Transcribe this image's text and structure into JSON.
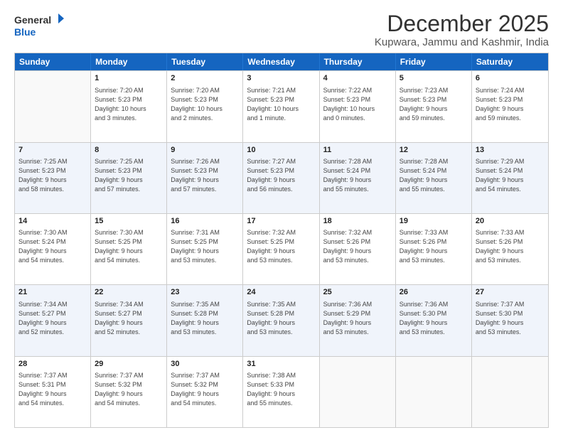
{
  "logo": {
    "line1": "General",
    "line2": "Blue"
  },
  "title": "December 2025",
  "subtitle": "Kupwara, Jammu and Kashmir, India",
  "days": [
    "Sunday",
    "Monday",
    "Tuesday",
    "Wednesday",
    "Thursday",
    "Friday",
    "Saturday"
  ],
  "rows": [
    [
      {
        "day": "",
        "info": ""
      },
      {
        "day": "1",
        "info": "Sunrise: 7:20 AM\nSunset: 5:23 PM\nDaylight: 10 hours\nand 3 minutes."
      },
      {
        "day": "2",
        "info": "Sunrise: 7:20 AM\nSunset: 5:23 PM\nDaylight: 10 hours\nand 2 minutes."
      },
      {
        "day": "3",
        "info": "Sunrise: 7:21 AM\nSunset: 5:23 PM\nDaylight: 10 hours\nand 1 minute."
      },
      {
        "day": "4",
        "info": "Sunrise: 7:22 AM\nSunset: 5:23 PM\nDaylight: 10 hours\nand 0 minutes."
      },
      {
        "day": "5",
        "info": "Sunrise: 7:23 AM\nSunset: 5:23 PM\nDaylight: 9 hours\nand 59 minutes."
      },
      {
        "day": "6",
        "info": "Sunrise: 7:24 AM\nSunset: 5:23 PM\nDaylight: 9 hours\nand 59 minutes."
      }
    ],
    [
      {
        "day": "7",
        "info": "Sunrise: 7:25 AM\nSunset: 5:23 PM\nDaylight: 9 hours\nand 58 minutes."
      },
      {
        "day": "8",
        "info": "Sunrise: 7:25 AM\nSunset: 5:23 PM\nDaylight: 9 hours\nand 57 minutes."
      },
      {
        "day": "9",
        "info": "Sunrise: 7:26 AM\nSunset: 5:23 PM\nDaylight: 9 hours\nand 57 minutes."
      },
      {
        "day": "10",
        "info": "Sunrise: 7:27 AM\nSunset: 5:23 PM\nDaylight: 9 hours\nand 56 minutes."
      },
      {
        "day": "11",
        "info": "Sunrise: 7:28 AM\nSunset: 5:24 PM\nDaylight: 9 hours\nand 55 minutes."
      },
      {
        "day": "12",
        "info": "Sunrise: 7:28 AM\nSunset: 5:24 PM\nDaylight: 9 hours\nand 55 minutes."
      },
      {
        "day": "13",
        "info": "Sunrise: 7:29 AM\nSunset: 5:24 PM\nDaylight: 9 hours\nand 54 minutes."
      }
    ],
    [
      {
        "day": "14",
        "info": "Sunrise: 7:30 AM\nSunset: 5:24 PM\nDaylight: 9 hours\nand 54 minutes."
      },
      {
        "day": "15",
        "info": "Sunrise: 7:30 AM\nSunset: 5:25 PM\nDaylight: 9 hours\nand 54 minutes."
      },
      {
        "day": "16",
        "info": "Sunrise: 7:31 AM\nSunset: 5:25 PM\nDaylight: 9 hours\nand 53 minutes."
      },
      {
        "day": "17",
        "info": "Sunrise: 7:32 AM\nSunset: 5:25 PM\nDaylight: 9 hours\nand 53 minutes."
      },
      {
        "day": "18",
        "info": "Sunrise: 7:32 AM\nSunset: 5:26 PM\nDaylight: 9 hours\nand 53 minutes."
      },
      {
        "day": "19",
        "info": "Sunrise: 7:33 AM\nSunset: 5:26 PM\nDaylight: 9 hours\nand 53 minutes."
      },
      {
        "day": "20",
        "info": "Sunrise: 7:33 AM\nSunset: 5:26 PM\nDaylight: 9 hours\nand 53 minutes."
      }
    ],
    [
      {
        "day": "21",
        "info": "Sunrise: 7:34 AM\nSunset: 5:27 PM\nDaylight: 9 hours\nand 52 minutes."
      },
      {
        "day": "22",
        "info": "Sunrise: 7:34 AM\nSunset: 5:27 PM\nDaylight: 9 hours\nand 52 minutes."
      },
      {
        "day": "23",
        "info": "Sunrise: 7:35 AM\nSunset: 5:28 PM\nDaylight: 9 hours\nand 53 minutes."
      },
      {
        "day": "24",
        "info": "Sunrise: 7:35 AM\nSunset: 5:28 PM\nDaylight: 9 hours\nand 53 minutes."
      },
      {
        "day": "25",
        "info": "Sunrise: 7:36 AM\nSunset: 5:29 PM\nDaylight: 9 hours\nand 53 minutes."
      },
      {
        "day": "26",
        "info": "Sunrise: 7:36 AM\nSunset: 5:30 PM\nDaylight: 9 hours\nand 53 minutes."
      },
      {
        "day": "27",
        "info": "Sunrise: 7:37 AM\nSunset: 5:30 PM\nDaylight: 9 hours\nand 53 minutes."
      }
    ],
    [
      {
        "day": "28",
        "info": "Sunrise: 7:37 AM\nSunset: 5:31 PM\nDaylight: 9 hours\nand 54 minutes."
      },
      {
        "day": "29",
        "info": "Sunrise: 7:37 AM\nSunset: 5:32 PM\nDaylight: 9 hours\nand 54 minutes."
      },
      {
        "day": "30",
        "info": "Sunrise: 7:37 AM\nSunset: 5:32 PM\nDaylight: 9 hours\nand 54 minutes."
      },
      {
        "day": "31",
        "info": "Sunrise: 7:38 AM\nSunset: 5:33 PM\nDaylight: 9 hours\nand 55 minutes."
      },
      {
        "day": "",
        "info": ""
      },
      {
        "day": "",
        "info": ""
      },
      {
        "day": "",
        "info": ""
      }
    ]
  ]
}
